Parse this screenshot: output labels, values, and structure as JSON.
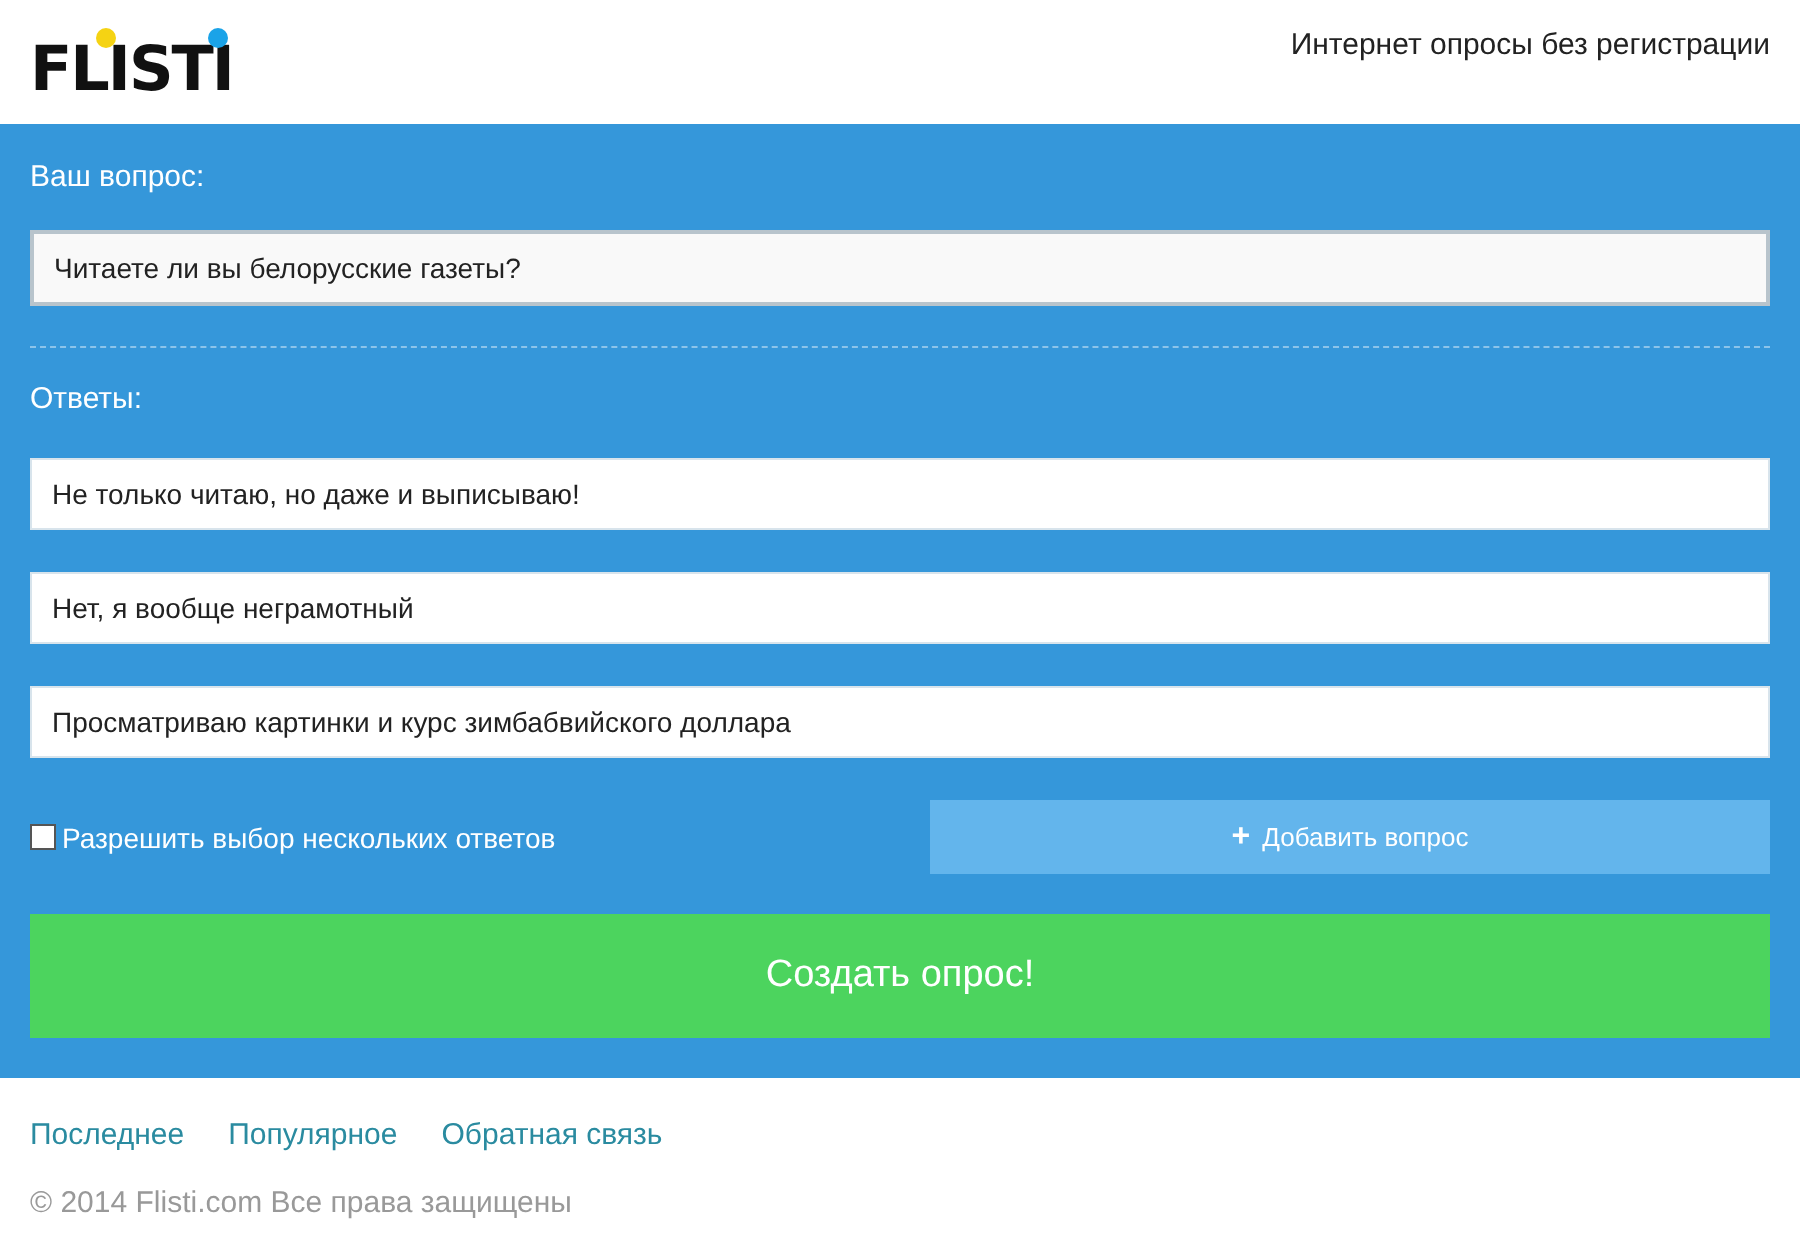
{
  "header": {
    "logo": "FLISTI",
    "tagline": "Интернет опросы без регистрации"
  },
  "form": {
    "question_label": "Ваш вопрос:",
    "question_value": "Читаете ли вы белорусские газеты?",
    "answers_label": "Ответы:",
    "answers": [
      {
        "value": "Не только читаю, но даже и выписываю!"
      },
      {
        "value": "Нет, я вообще неграмотный"
      },
      {
        "value": "Просматриваю картинки и курс зимбабвийского доллара"
      }
    ],
    "multiple": {
      "label": "Разрешить выбор нескольких ответов",
      "checked": false
    },
    "add_button": {
      "icon": "+",
      "label": "Добавить вопрос"
    },
    "submit": "Создать опрос!"
  },
  "footer": {
    "links": [
      "Последнее",
      "Популярное",
      "Обратная связь"
    ],
    "copyright": "© 2014 Flisti.com Все права защищены"
  }
}
